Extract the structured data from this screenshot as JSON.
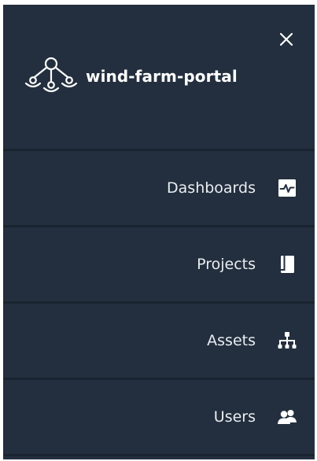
{
  "app": {
    "title": "wind-farm-portal"
  },
  "icons": {
    "close": "close-icon",
    "brand": "wind-farm-logo-icon",
    "dashboards": "dashboard-pulse-icon",
    "projects": "book-icon",
    "assets": "hierarchy-icon",
    "users": "users-icon"
  },
  "nav": {
    "items": [
      {
        "label": "Dashboards"
      },
      {
        "label": "Projects"
      },
      {
        "label": "Assets"
      },
      {
        "label": "Users"
      }
    ]
  },
  "colors": {
    "panel_bg": "#232f3e",
    "text": "#ffffff"
  }
}
